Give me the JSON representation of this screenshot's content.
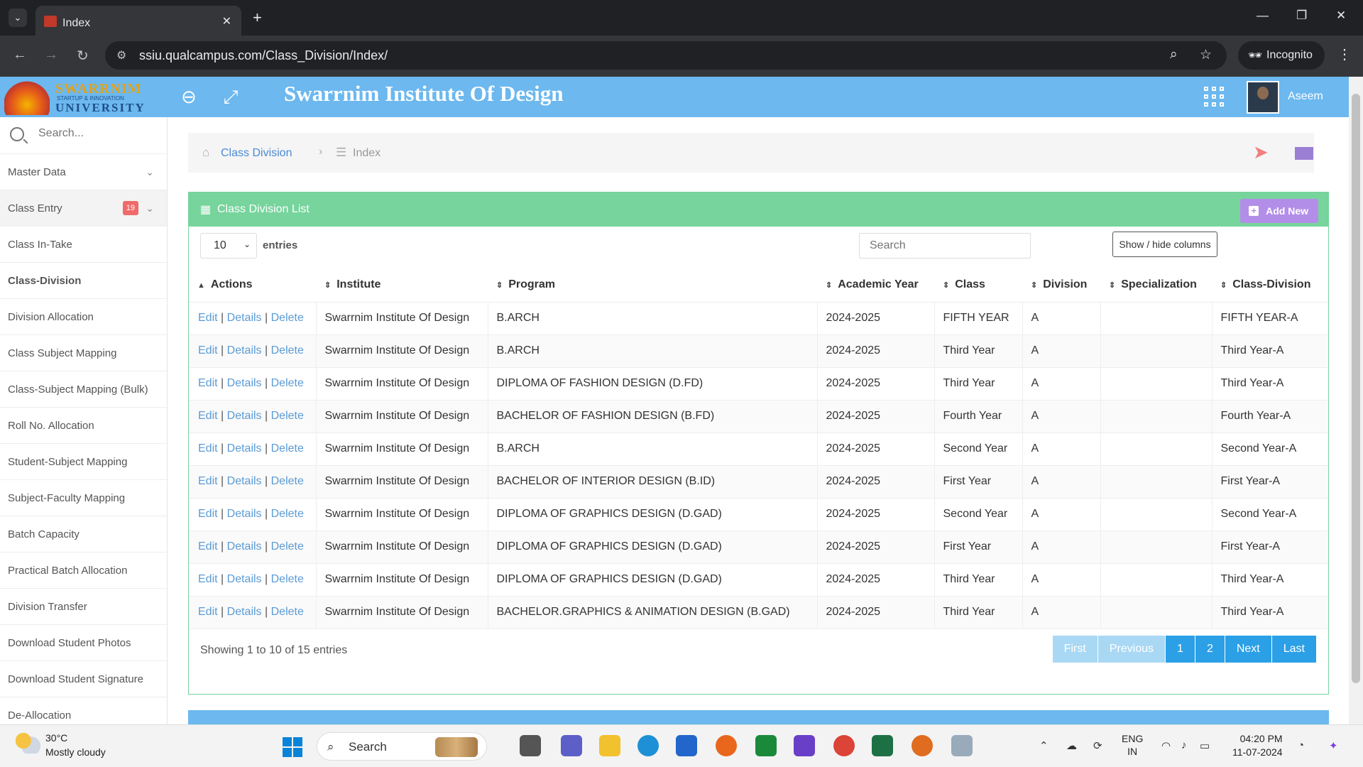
{
  "browser": {
    "tab_title": "Index",
    "url": "ssiu.qualcampus.com/Class_Division/Index/",
    "incognito_label": "Incognito",
    "tab_close": "✕",
    "new_tab": "+"
  },
  "header": {
    "logo_line1": "SWARRNIM",
    "logo_line2": "STARTUP & INNOVATION",
    "logo_line3": "UNIVERSITY",
    "institute_title": "Swarrnim Institute Of Design",
    "user_name": "Aseem"
  },
  "sidebar": {
    "search_placeholder": "Search...",
    "items": [
      {
        "label": "Master Data"
      },
      {
        "label": "Class Entry",
        "badge": "19"
      },
      {
        "label": "Class In-Take"
      },
      {
        "label": "Class-Division"
      },
      {
        "label": "Division Allocation"
      },
      {
        "label": "Class Subject Mapping"
      },
      {
        "label": "Class-Subject Mapping (Bulk)"
      },
      {
        "label": "Roll No. Allocation"
      },
      {
        "label": "Student-Subject Mapping"
      },
      {
        "label": "Subject-Faculty Mapping"
      },
      {
        "label": "Batch Capacity"
      },
      {
        "label": "Practical Batch Allocation"
      },
      {
        "label": "Division Transfer"
      },
      {
        "label": "Download Student Photos"
      },
      {
        "label": "Download Student Signature"
      },
      {
        "label": "De-Allocation"
      }
    ]
  },
  "breadcrumb": {
    "parent": "Class Division",
    "current": "Index"
  },
  "panel": {
    "title": "Class Division List",
    "add_new": "Add New",
    "page_length": "10",
    "entries_label": "entries",
    "search_placeholder": "Search",
    "show_hide_columns": "Show / hide columns",
    "info": "Showing 1 to 10 of 15 entries"
  },
  "table": {
    "headers": [
      "Actions",
      "Institute",
      "Program",
      "Academic Year",
      "Class",
      "Division",
      "Specialization",
      "Class-Division"
    ],
    "action_links": {
      "edit": "Edit",
      "details": "Details",
      "delete": "Delete",
      "sep": "|"
    },
    "rows": [
      {
        "institute": "Swarrnim Institute Of Design",
        "program": "B.ARCH",
        "year": "2024-2025",
        "class": "FIFTH YEAR",
        "division": "A",
        "specialization": "",
        "class_division": "FIFTH YEAR-A"
      },
      {
        "institute": "Swarrnim Institute Of Design",
        "program": "B.ARCH",
        "year": "2024-2025",
        "class": "Third Year",
        "division": "A",
        "specialization": "",
        "class_division": "Third Year-A"
      },
      {
        "institute": "Swarrnim Institute Of Design",
        "program": "DIPLOMA OF FASHION DESIGN (D.FD)",
        "year": "2024-2025",
        "class": "Third Year",
        "division": "A",
        "specialization": "",
        "class_division": "Third Year-A"
      },
      {
        "institute": "Swarrnim Institute Of Design",
        "program": "BACHELOR OF FASHION DESIGN (B.FD)",
        "year": "2024-2025",
        "class": "Fourth Year",
        "division": "A",
        "specialization": "",
        "class_division": "Fourth Year-A"
      },
      {
        "institute": "Swarrnim Institute Of Design",
        "program": "B.ARCH",
        "year": "2024-2025",
        "class": "Second Year",
        "division": "A",
        "specialization": "",
        "class_division": "Second Year-A"
      },
      {
        "institute": "Swarrnim Institute Of Design",
        "program": "BACHELOR OF INTERIOR DESIGN (B.ID)",
        "year": "2024-2025",
        "class": "First Year",
        "division": "A",
        "specialization": "",
        "class_division": "First Year-A"
      },
      {
        "institute": "Swarrnim Institute Of Design",
        "program": "DIPLOMA OF GRAPHICS DESIGN (D.GAD)",
        "year": "2024-2025",
        "class": "Second Year",
        "division": "A",
        "specialization": "",
        "class_division": "Second Year-A"
      },
      {
        "institute": "Swarrnim Institute Of Design",
        "program": "DIPLOMA OF GRAPHICS DESIGN (D.GAD)",
        "year": "2024-2025",
        "class": "First Year",
        "division": "A",
        "specialization": "",
        "class_division": "First Year-A"
      },
      {
        "institute": "Swarrnim Institute Of Design",
        "program": "DIPLOMA OF GRAPHICS DESIGN (D.GAD)",
        "year": "2024-2025",
        "class": "Third Year",
        "division": "A",
        "specialization": "",
        "class_division": "Third Year-A"
      },
      {
        "institute": "Swarrnim Institute Of Design",
        "program": "BACHELOR.GRAPHICS & ANIMATION DESIGN (B.GAD)",
        "year": "2024-2025",
        "class": "Third Year",
        "division": "A",
        "specialization": "",
        "class_division": "Third Year-A"
      }
    ]
  },
  "pagination": {
    "first": "First",
    "previous": "Previous",
    "pages": [
      "1",
      "2"
    ],
    "next": "Next",
    "last": "Last"
  },
  "taskbar": {
    "temperature": "30°C",
    "weather": "Mostly cloudy",
    "search_label": "Search",
    "lang_line1": "ENG",
    "lang_line2": "IN",
    "time": "04:20 PM",
    "date": "11-07-2024"
  },
  "colors": {
    "header_blue": "#6cb8ef",
    "panel_green": "#76d49c",
    "add_new_purple": "#b38ee8",
    "pager_blue": "#2ba0e6",
    "link_blue": "#5b9bd5"
  }
}
